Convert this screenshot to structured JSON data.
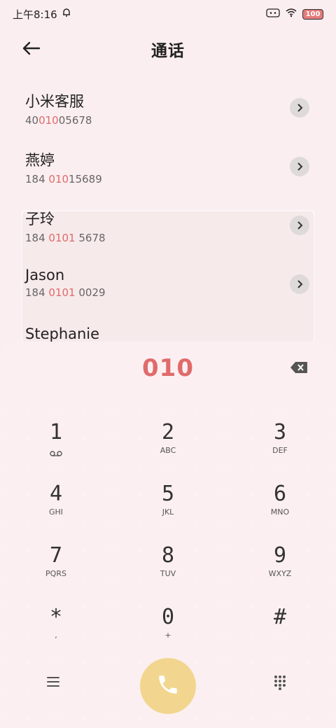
{
  "status_bar": {
    "time": "上午8:16",
    "battery": "100"
  },
  "header": {
    "title": "通话"
  },
  "contacts": [
    {
      "name": "小米客服",
      "number_pre": "40",
      "number_hl": "010",
      "number_post": "05678"
    },
    {
      "name": "燕婷",
      "number_pre": "184 ",
      "number_hl": "010",
      "number_post": "15689"
    },
    {
      "name": "子玲",
      "number_pre": "184 ",
      "number_hl": "0101",
      "number_post": " 5678"
    },
    {
      "name": "Jason",
      "number_pre": "184 ",
      "number_hl": "0101",
      "number_post": " 0029"
    },
    {
      "name": "Stephanie",
      "number_pre": "",
      "number_hl": "",
      "number_post": ""
    }
  ],
  "dialer": {
    "input": "010",
    "keys": [
      {
        "digit": "1",
        "letters": ""
      },
      {
        "digit": "2",
        "letters": "ABC"
      },
      {
        "digit": "3",
        "letters": "DEF"
      },
      {
        "digit": "4",
        "letters": "GHI"
      },
      {
        "digit": "5",
        "letters": "JKL"
      },
      {
        "digit": "6",
        "letters": "MNO"
      },
      {
        "digit": "7",
        "letters": "PQRS"
      },
      {
        "digit": "8",
        "letters": "TUV"
      },
      {
        "digit": "9",
        "letters": "WXYZ"
      },
      {
        "digit": "*",
        "letters": ","
      },
      {
        "digit": "0",
        "letters": "+"
      },
      {
        "digit": "#",
        "letters": ""
      }
    ]
  },
  "colors": {
    "highlight": "#e06a6a",
    "call_button": "#f2d690",
    "background": "#fbeef0"
  },
  "icons": {
    "back": "arrow-left-icon",
    "detail": "chevron-right-icon",
    "backspace": "backspace-icon",
    "voicemail": "voicemail-icon",
    "menu": "menu-icon",
    "call": "phone-icon",
    "keypad": "dialpad-icon"
  }
}
